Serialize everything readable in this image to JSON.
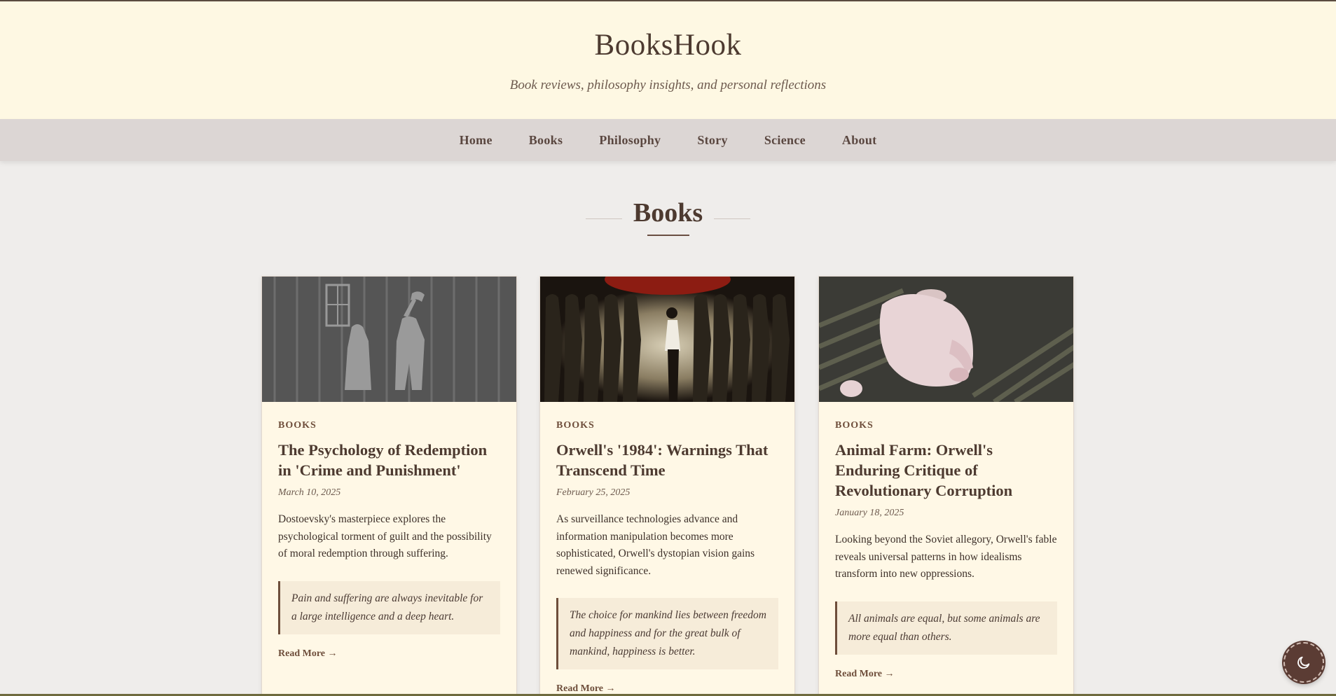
{
  "site": {
    "title": "BooksHook",
    "tagline": "Book reviews, philosophy insights, and personal reflections"
  },
  "nav": {
    "items": [
      "Home",
      "Books",
      "Philosophy",
      "Story",
      "Science",
      "About"
    ]
  },
  "section": {
    "title": "Books"
  },
  "cards": [
    {
      "image_icon": "crime-and-punishment-illustration",
      "category": "BOOKS",
      "title": "The Psychology of Redemption in 'Crime and Punishment'",
      "date": "March 10, 2025",
      "excerpt": "Dostoevsky's masterpiece explores the psychological torment of guilt and the possibility of moral redemption through suffering.",
      "quote": "Pain and suffering are always inevitable for a large intelligence and a deep heart.",
      "read_more": "Read More →"
    },
    {
      "image_icon": "1984-illustration",
      "category": "BOOKS",
      "title": "Orwell's '1984': Warnings That Transcend Time",
      "date": "February 25, 2025",
      "excerpt": "As surveillance technologies advance and information manipulation becomes more sophisticated, Orwell's dystopian vision gains renewed significance.",
      "quote": "The choice for mankind lies between freedom and happiness and for the great bulk of mankind, happiness is better.",
      "read_more": "Read More →"
    },
    {
      "image_icon": "animal-farm-pig-photo",
      "category": "BOOKS",
      "title": "Animal Farm: Orwell's Enduring Critique of Revolutionary Corruption",
      "date": "January 18, 2025",
      "excerpt": "Looking beyond the Soviet allegory, Orwell's fable reveals universal patterns in how idealisms transform into new oppressions.",
      "quote": "All animals are equal, but some animals are more equal than others.",
      "read_more": "Read More →"
    }
  ],
  "theme_toggle": {
    "icon": "moon-icon"
  },
  "colors": {
    "header_bg": "#fef8e3",
    "nav_bg": "#dcd6d4",
    "page_bg": "#efedeb",
    "card_bg": "#fff8e6",
    "accent": "#6e4e3b",
    "toggle_bg": "#5b3c34"
  }
}
